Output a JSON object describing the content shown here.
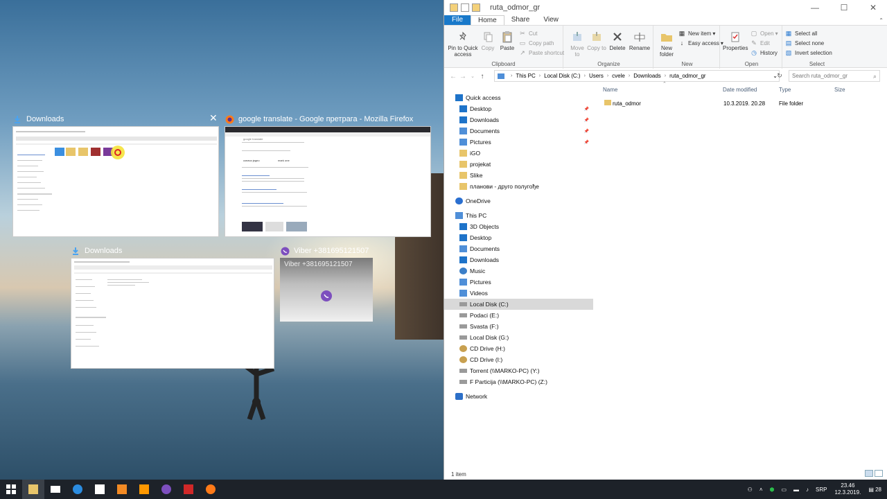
{
  "task_view": {
    "windows": [
      {
        "title": "Downloads",
        "close": "✕"
      },
      {
        "title": "google translate - Google претрага - Mozilla Firefox"
      },
      {
        "title": "Downloads"
      },
      {
        "title": "Viber +381695121507",
        "inner_text": "Viber +381695121507"
      }
    ],
    "firefox_thumb": {
      "search_text": "google translate",
      "text1": "означи једно",
      "text2": "mark one"
    }
  },
  "explorer": {
    "title": "ruta_odmor_gr",
    "window_controls": {
      "minimize": "—",
      "maximize": "☐",
      "close": "✕"
    },
    "tabs": [
      "File",
      "Home",
      "Share",
      "View"
    ],
    "ribbon": {
      "clipboard": {
        "label": "Clipboard",
        "pin": "Pin to Quick access",
        "copy": "Copy",
        "paste": "Paste",
        "cut": "Cut",
        "copy_path": "Copy path",
        "paste_shortcut": "Paste shortcut"
      },
      "organize": {
        "label": "Organize",
        "move_to": "Move to",
        "copy_to": "Copy to",
        "delete": "Delete",
        "rename": "Rename"
      },
      "new": {
        "label": "New",
        "new_folder": "New folder",
        "new_item": "New item",
        "easy_access": "Easy access"
      },
      "open": {
        "label": "Open",
        "properties": "Properties",
        "open": "Open",
        "edit": "Edit",
        "history": "History"
      },
      "select": {
        "label": "Select",
        "select_all": "Select all",
        "select_none": "Select none",
        "invert": "Invert selection"
      }
    },
    "address": {
      "crumbs": [
        "This PC",
        "Local Disk (C:)",
        "Users",
        "cvele",
        "Downloads",
        "ruta_odmor_gr"
      ]
    },
    "search": {
      "placeholder": "Search ruta_odmor_gr"
    },
    "nav": [
      {
        "label": "Quick access",
        "icon": "star-icon",
        "level": 0
      },
      {
        "label": "Desktop",
        "icon": "desktop-icon",
        "level": 1,
        "pinned": true
      },
      {
        "label": "Downloads",
        "icon": "download-icon",
        "level": 1,
        "pinned": true
      },
      {
        "label": "Documents",
        "icon": "documents-icon",
        "level": 1,
        "pinned": true
      },
      {
        "label": "Pictures",
        "icon": "pictures-icon",
        "level": 1,
        "pinned": true
      },
      {
        "label": "iGO",
        "icon": "folder-icon",
        "level": 1
      },
      {
        "label": "projekat",
        "icon": "folder-icon",
        "level": 1
      },
      {
        "label": "Slike",
        "icon": "folder-icon",
        "level": 1
      },
      {
        "label": "планови - друго полугође",
        "icon": "folder-icon",
        "level": 1
      },
      {
        "label": "OneDrive",
        "icon": "cloud-icon",
        "level": 0,
        "gap": true
      },
      {
        "label": "This PC",
        "icon": "computer-icon",
        "level": 0,
        "gap": true
      },
      {
        "label": "3D Objects",
        "icon": "cube-icon",
        "level": 1
      },
      {
        "label": "Desktop",
        "icon": "desktop-icon",
        "level": 1
      },
      {
        "label": "Documents",
        "icon": "documents-icon",
        "level": 1
      },
      {
        "label": "Downloads",
        "icon": "download-icon",
        "level": 1
      },
      {
        "label": "Music",
        "icon": "music-icon",
        "level": 1
      },
      {
        "label": "Pictures",
        "icon": "pictures-icon",
        "level": 1
      },
      {
        "label": "Videos",
        "icon": "video-icon",
        "level": 1
      },
      {
        "label": "Local Disk (C:)",
        "icon": "drive-icon",
        "level": 1,
        "selected": true
      },
      {
        "label": "Podaci (E:)",
        "icon": "drive-icon",
        "level": 1
      },
      {
        "label": "Svasta (F:)",
        "icon": "drive-icon",
        "level": 1
      },
      {
        "label": "Local Disk (G:)",
        "icon": "drive-icon",
        "level": 1
      },
      {
        "label": "CD Drive (H:)",
        "icon": "cd-drive-icon",
        "level": 1
      },
      {
        "label": "CD Drive (I:)",
        "icon": "cd-drive-icon",
        "level": 1
      },
      {
        "label": "Torrent (\\\\MARKO-PC) (Y:)",
        "icon": "network-drive-icon",
        "level": 1
      },
      {
        "label": "F Particija (\\\\MARKO-PC) (Z:)",
        "icon": "network-drive-icon",
        "level": 1
      },
      {
        "label": "Network",
        "icon": "network-icon",
        "level": 0,
        "gap": true
      }
    ],
    "columns": [
      "Name",
      "Date modified",
      "Type",
      "Size"
    ],
    "files": [
      {
        "name": "ruta_odmor",
        "date": "10.3.2019. 20.28",
        "type": "File folder",
        "size": ""
      }
    ],
    "status": "1 item"
  },
  "taskbar": {
    "tray": {
      "lang": "SRP",
      "time": "23.46",
      "date": "12.3.2019.",
      "notifications": "28"
    }
  },
  "colors": {
    "accent": "#1979ca",
    "taskbar": "#1d2229",
    "folder": "#e8c56a"
  }
}
